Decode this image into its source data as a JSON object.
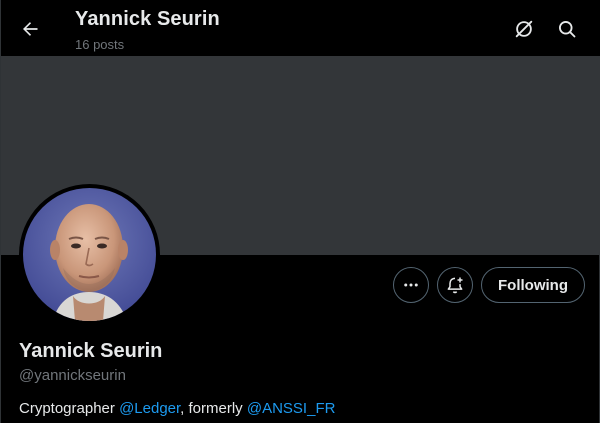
{
  "header": {
    "title": "Yannick Seurin",
    "post_count": "16 posts"
  },
  "profile": {
    "display_name": "Yannick Seurin",
    "handle": "@yannickseurin",
    "bio": {
      "prefix": "Cryptographer ",
      "mention1": "@Ledger",
      "middle": ", formerly ",
      "mention2": "@ANSSI_FR"
    }
  },
  "actions": {
    "follow_label": "Following"
  },
  "icons": {
    "back": "arrow-left-icon",
    "grok": "grok-icon",
    "search": "search-icon",
    "more": "more-icon",
    "notify": "bell-plus-icon"
  },
  "colors": {
    "background": "#000000",
    "banner": "#333639",
    "link": "#1d9bf0",
    "muted": "#71767b",
    "border": "#536471"
  }
}
